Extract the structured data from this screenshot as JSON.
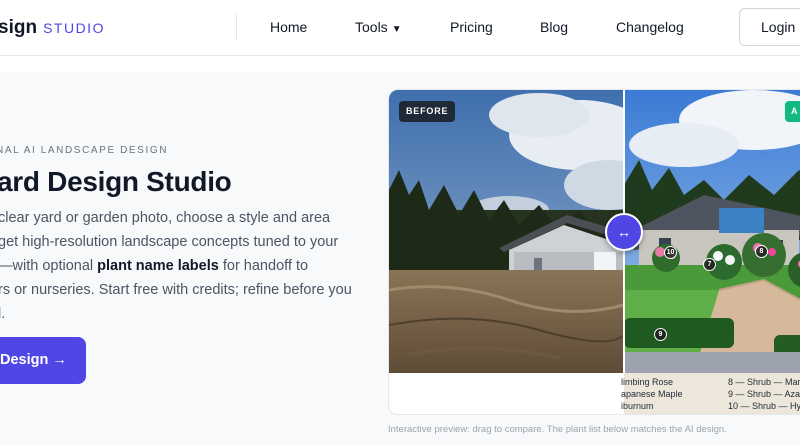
{
  "header": {
    "brand_main": "sign",
    "brand_sub": "STUDIO",
    "nav": {
      "home": "Home",
      "tools": "Tools",
      "pricing": "Pricing",
      "blog": "Blog",
      "changelog": "Changelog"
    },
    "login_label": "Login"
  },
  "hero": {
    "eyebrow": "NAL AI LANDSCAPE DESIGN",
    "title": "ard Design Studio",
    "lead_line1": "clear yard or garden photo, choose a style and area",
    "lead_line2": "get high-resolution landscape concepts tuned to your",
    "lead_line3_pre": "—with optional ",
    "lead_line3_bold": "plant name labels",
    "lead_line3_post": " for handoff to",
    "lead_line4": "rs or nurseries. Start free with credits; refine before you",
    "lead_line5": "l.",
    "cta_label": "Design →"
  },
  "preview": {
    "before_badge": "BEFORE",
    "after_badge": "A",
    "handle_icon": "↔",
    "pins": [
      "10",
      "8",
      "7",
      "9"
    ],
    "plant_list": [
      {
        "left": "limbing Rose",
        "right": "8 — Shrub — Mar"
      },
      {
        "left": "apanese Maple",
        "right": "9 — Shrub — Azal"
      },
      {
        "left": "iburnum",
        "right": "10 — Shrub — Hyd"
      }
    ],
    "caption": "Interactive preview: drag to compare. The plant list below matches the AI design."
  },
  "colors": {
    "accent": "#4f46e5",
    "after_badge": "#10b981",
    "before_badge": "#1f2937"
  }
}
